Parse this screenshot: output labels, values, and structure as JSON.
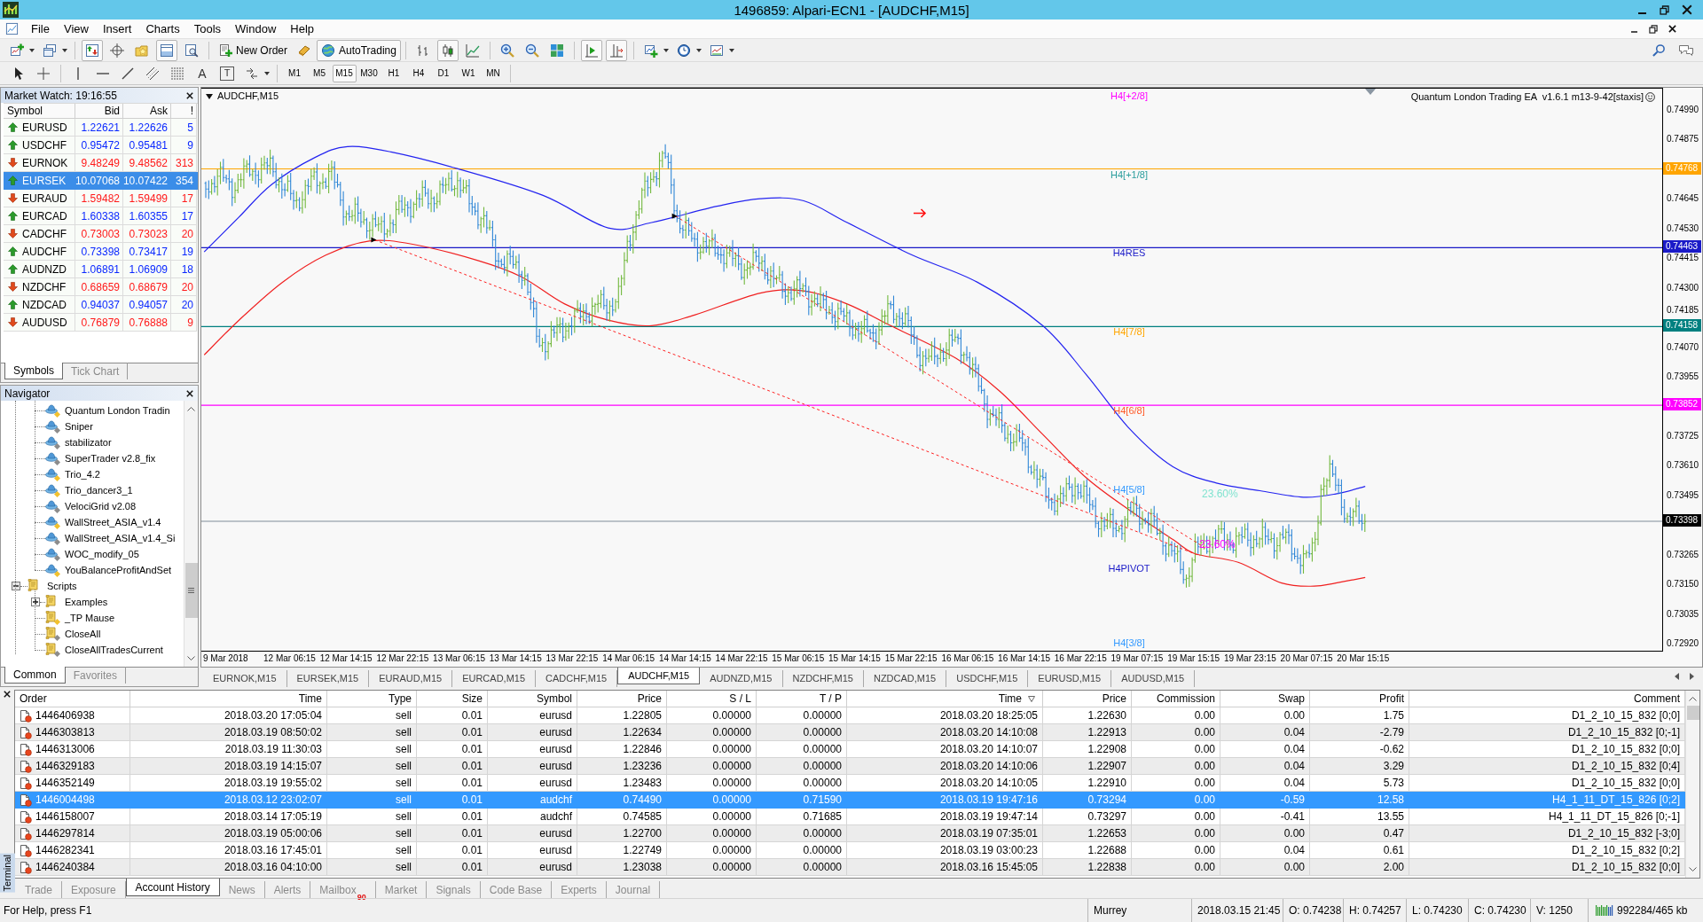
{
  "window": {
    "title": "1496859: Alpari-ECN1 - [AUDCHF,M15]"
  },
  "menu": [
    "File",
    "View",
    "Insert",
    "Charts",
    "Tools",
    "Window",
    "Help"
  ],
  "toolbar": {
    "items": [
      {
        "kind": "icon",
        "pressed": false
      },
      {
        "kind": "icon",
        "pressed": false
      },
      {
        "kind": "icon",
        "pressed": true
      },
      {
        "kind": "icon",
        "pressed": false
      },
      {
        "kind": "icon",
        "pressed": false
      },
      {
        "kind": "icon",
        "pressed": true
      },
      {
        "kind": "icon",
        "pressed": false
      },
      {
        "kind": "text",
        "label": "New Order",
        "pressed": false
      },
      {
        "kind": "icon",
        "pressed": false
      },
      {
        "kind": "text",
        "label": "AutoTrading",
        "pressed": true
      },
      {
        "kind": "icon",
        "pressed": false
      },
      {
        "kind": "icon",
        "pressed": true
      },
      {
        "kind": "icon",
        "pressed": false
      },
      {
        "kind": "icon",
        "pressed": false
      },
      {
        "kind": "icon",
        "pressed": false
      },
      {
        "kind": "icon",
        "pressed": false
      },
      {
        "kind": "icon",
        "pressed": true
      },
      {
        "kind": "icon",
        "pressed": true
      },
      {
        "kind": "icon",
        "pressed": false
      },
      {
        "kind": "icon",
        "pressed": false
      },
      {
        "kind": "icon",
        "pressed": false
      }
    ]
  },
  "drawing_tools": {
    "text_tool": "A",
    "text_label_tool": "T"
  },
  "timeframes": [
    {
      "label": "M1",
      "selected": false
    },
    {
      "label": "M5",
      "selected": false
    },
    {
      "label": "M15",
      "selected": true
    },
    {
      "label": "M30",
      "selected": false
    },
    {
      "label": "H1",
      "selected": false
    },
    {
      "label": "H4",
      "selected": false
    },
    {
      "label": "D1",
      "selected": false
    },
    {
      "label": "W1",
      "selected": false
    },
    {
      "label": "MN",
      "selected": false
    }
  ],
  "market_watch": {
    "title": "Market Watch: 19:16:55",
    "columns": [
      "Symbol",
      "Bid",
      "Ask",
      "!"
    ],
    "rows": [
      {
        "symbol": "EURUSD",
        "bid": "1.22621",
        "ask": "1.22626",
        "spread": "5",
        "rising": true,
        "selected": false
      },
      {
        "symbol": "USDCHF",
        "bid": "0.95472",
        "ask": "0.95481",
        "spread": "9",
        "rising": true,
        "selected": false
      },
      {
        "symbol": "EURNOK",
        "bid": "9.48249",
        "ask": "9.48562",
        "spread": "313",
        "rising": false,
        "selected": false
      },
      {
        "symbol": "EURSEK",
        "bid": "10.07068",
        "ask": "10.07422",
        "spread": "354",
        "rising": true,
        "selected": true
      },
      {
        "symbol": "EURAUD",
        "bid": "1.59482",
        "ask": "1.59499",
        "spread": "17",
        "rising": false,
        "selected": false
      },
      {
        "symbol": "EURCAD",
        "bid": "1.60338",
        "ask": "1.60355",
        "spread": "17",
        "rising": true,
        "selected": false
      },
      {
        "symbol": "CADCHF",
        "bid": "0.73003",
        "ask": "0.73023",
        "spread": "20",
        "rising": false,
        "selected": false
      },
      {
        "symbol": "AUDCHF",
        "bid": "0.73398",
        "ask": "0.73417",
        "spread": "19",
        "rising": true,
        "selected": false
      },
      {
        "symbol": "AUDNZD",
        "bid": "1.06891",
        "ask": "1.06909",
        "spread": "18",
        "rising": true,
        "selected": false
      },
      {
        "symbol": "NZDCHF",
        "bid": "0.68659",
        "ask": "0.68679",
        "spread": "20",
        "rising": false,
        "selected": false
      },
      {
        "symbol": "NZDCAD",
        "bid": "0.94037",
        "ask": "0.94057",
        "spread": "20",
        "rising": true,
        "selected": false
      },
      {
        "symbol": "AUDUSD",
        "bid": "0.76879",
        "ask": "0.76888",
        "spread": "9",
        "rising": false,
        "selected": false
      }
    ],
    "tabs": [
      {
        "label": "Symbols",
        "selected": true
      },
      {
        "label": "Tick Chart",
        "selected": false
      }
    ]
  },
  "navigator": {
    "title": "Navigator",
    "experts": [
      {
        "label": "Quantum London Tradin",
        "color": "#f2c12e"
      },
      {
        "label": "Sniper",
        "color": "#8c8c8c"
      },
      {
        "label": "stabilizator",
        "color": "#8c8c8c"
      },
      {
        "label": "SuperTrader v2.8_fix",
        "color": "#8c8c8c"
      },
      {
        "label": "Trio_4.2",
        "color": "#f2c12e"
      },
      {
        "label": "Trio_dancer3_1",
        "color": "#f2c12e"
      },
      {
        "label": "VelociGrid v2.08",
        "color": "#8c8c8c"
      },
      {
        "label": "WallStreet_ASIA_v1.4",
        "color": "#f2c12e"
      },
      {
        "label": "WallStreet_ASIA_v1.4_Si",
        "color": "#8c8c8c"
      },
      {
        "label": "WOC_modify_05",
        "color": "#8c8c8c"
      },
      {
        "label": "YouBalanceProfitAndSet",
        "color": "#f2c12e"
      }
    ],
    "scripts": {
      "label": "Scripts",
      "expanded": true,
      "children": [
        {
          "label": "Examples",
          "folder": true,
          "expanded": false
        },
        {
          "label": "_TP Mause",
          "folder": false,
          "color": "#f2c12e"
        },
        {
          "label": "CloseAll",
          "folder": false,
          "color": "#8c8c8c"
        },
        {
          "label": "CloseAllTradesCurrent",
          "folder": false,
          "color": "#8c8c8c"
        }
      ]
    },
    "tabs": [
      {
        "label": "Common",
        "selected": true
      },
      {
        "label": "Favorites",
        "selected": false
      }
    ]
  },
  "chart": {
    "title": "AUDCHF,M15",
    "expert_label": "Quantum London Trading EA  v1.6.1 m13-9-42[staxis]",
    "levels": [
      {
        "label": "H4[+2/8]",
        "color": "#ff00ff"
      },
      {
        "label": "H4[+1/8]",
        "color": "#2a9d9d",
        "line": {
          "color": "#ffa500",
          "tag": "0.74768"
        }
      },
      {
        "label": "H4RES",
        "color": "#1a1ac8",
        "line": {
          "color": "#1a1ac8",
          "tag": "0.74463"
        }
      },
      {
        "label": "H4[7/8]",
        "color": "#ffa500",
        "line": {
          "color": "#008080",
          "tag": "0.74158"
        }
      },
      {
        "label": "H4[6/8]",
        "color": "#ff5a28",
        "line": {
          "color": "#ff00ff",
          "tag": "0.73852"
        }
      },
      {
        "label": "H4[5/8]",
        "color": "#3399ff"
      },
      {
        "label": "H4PIVOT",
        "color": "#1a1ac8"
      },
      {
        "label": "H4[3/8]",
        "color": "#3399ff"
      }
    ],
    "fib_labels": [
      {
        "text": "23.60%",
        "color": "#7fe3cf"
      },
      {
        "text": "23.60%",
        "color": "#ff00ff"
      }
    ],
    "current_price": {
      "tag": "0.73398"
    },
    "price_axis": [
      "0.74990",
      "0.74875",
      "0.74645",
      "0.74530",
      "0.74415",
      "0.74300",
      "0.74185",
      "0.74070",
      "0.73955",
      "0.73725",
      "0.73610",
      "0.73495",
      "0.73265",
      "0.73150",
      "0.73035",
      "0.72920"
    ],
    "time_axis": [
      "9 Mar 2018",
      "12 Mar 06:15",
      "12 Mar 14:15",
      "12 Mar 22:15",
      "13 Mar 06:15",
      "13 Mar 14:15",
      "13 Mar 22:15",
      "14 Mar 06:15",
      "14 Mar 14:15",
      "14 Mar 22:15",
      "15 Mar 06:15",
      "15 Mar 14:15",
      "15 Mar 22:15",
      "16 Mar 06:15",
      "16 Mar 14:15",
      "16 Mar 22:15",
      "19 Mar 07:15",
      "19 Mar 15:15",
      "19 Mar 23:15",
      "20 Mar 07:15",
      "20 Mar 15:15"
    ]
  },
  "chart_tabs": [
    {
      "label": "EURNOK,M15",
      "selected": false
    },
    {
      "label": "EURSEK,M15",
      "selected": false
    },
    {
      "label": "EURAUD,M15",
      "selected": false
    },
    {
      "label": "EURCAD,M15",
      "selected": false
    },
    {
      "label": "CADCHF,M15",
      "selected": false
    },
    {
      "label": "AUDCHF,M15",
      "selected": true
    },
    {
      "label": "AUDNZD,M15",
      "selected": false
    },
    {
      "label": "NZDCHF,M15",
      "selected": false
    },
    {
      "label": "NZDCAD,M15",
      "selected": false
    },
    {
      "label": "USDCHF,M15",
      "selected": false
    },
    {
      "label": "EURUSD,M15",
      "selected": false
    },
    {
      "label": "AUDUSD,M15",
      "selected": false
    }
  ],
  "terminal": {
    "title": "Terminal",
    "columns": [
      {
        "label": "Order",
        "sorted": false
      },
      {
        "label": "Time",
        "sorted": false
      },
      {
        "label": "Type",
        "sorted": false
      },
      {
        "label": "Size",
        "sorted": false
      },
      {
        "label": "Symbol",
        "sorted": false
      },
      {
        "label": "Price",
        "sorted": false
      },
      {
        "label": "S / L",
        "sorted": false
      },
      {
        "label": "T / P",
        "sorted": false
      },
      {
        "label": "Time",
        "sorted": true
      },
      {
        "label": "Price",
        "sorted": false
      },
      {
        "label": "Commission",
        "sorted": false
      },
      {
        "label": "Swap",
        "sorted": false
      },
      {
        "label": "Profit",
        "sorted": false
      },
      {
        "label": "Comment",
        "sorted": false
      }
    ],
    "rows": [
      {
        "order": "1446406938",
        "time": "2018.03.20 17:05:04",
        "type": "sell",
        "size": "0.01",
        "symbol": "eurusd",
        "price": "1.22805",
        "sl": "0.00000",
        "tp": "0.00000",
        "close_time": "2018.03.20 18:25:05",
        "close_price": "1.22630",
        "commission": "0.00",
        "swap": "0.00",
        "profit": "1.75",
        "comment": "D1_2_10_15_832 [0;0]",
        "selected": false
      },
      {
        "order": "1446303813",
        "time": "2018.03.19 08:50:02",
        "type": "sell",
        "size": "0.01",
        "symbol": "eurusd",
        "price": "1.22634",
        "sl": "0.00000",
        "tp": "0.00000",
        "close_time": "2018.03.20 14:10:08",
        "close_price": "1.22913",
        "commission": "0.00",
        "swap": "0.04",
        "profit": "-2.79",
        "comment": "D1_2_10_15_832 [0;-1]",
        "selected": false
      },
      {
        "order": "1446313006",
        "time": "2018.03.19 11:30:03",
        "type": "sell",
        "size": "0.01",
        "symbol": "eurusd",
        "price": "1.22846",
        "sl": "0.00000",
        "tp": "0.00000",
        "close_time": "2018.03.20 14:10:07",
        "close_price": "1.22908",
        "commission": "0.00",
        "swap": "0.04",
        "profit": "-0.62",
        "comment": "D1_2_10_15_832 [0;0]",
        "selected": false
      },
      {
        "order": "1446329183",
        "time": "2018.03.19 14:15:07",
        "type": "sell",
        "size": "0.01",
        "symbol": "eurusd",
        "price": "1.23236",
        "sl": "0.00000",
        "tp": "0.00000",
        "close_time": "2018.03.20 14:10:06",
        "close_price": "1.22907",
        "commission": "0.00",
        "swap": "0.04",
        "profit": "3.29",
        "comment": "D1_2_10_15_832 [0;4]",
        "selected": false
      },
      {
        "order": "1446352149",
        "time": "2018.03.19 19:55:02",
        "type": "sell",
        "size": "0.01",
        "symbol": "eurusd",
        "price": "1.23483",
        "sl": "0.00000",
        "tp": "0.00000",
        "close_time": "2018.03.20 14:10:05",
        "close_price": "1.22910",
        "commission": "0.00",
        "swap": "0.04",
        "profit": "5.73",
        "comment": "D1_2_10_15_832 [0;0]",
        "selected": false
      },
      {
        "order": "1446004498",
        "time": "2018.03.12 23:02:07",
        "type": "sell",
        "size": "0.01",
        "symbol": "audchf",
        "price": "0.74490",
        "sl": "0.00000",
        "tp": "0.71590",
        "close_time": "2018.03.19 19:47:16",
        "close_price": "0.73294",
        "commission": "0.00",
        "swap": "-0.59",
        "profit": "12.58",
        "comment": "H4_1_11_DT_15_826 [0;2]",
        "selected": true
      },
      {
        "order": "1446158007",
        "time": "2018.03.14 17:05:19",
        "type": "sell",
        "size": "0.01",
        "symbol": "audchf",
        "price": "0.74585",
        "sl": "0.00000",
        "tp": "0.71685",
        "close_time": "2018.03.19 19:47:14",
        "close_price": "0.73297",
        "commission": "0.00",
        "swap": "-0.41",
        "profit": "13.55",
        "comment": "H4_1_11_DT_15_826 [0;-1]",
        "selected": false
      },
      {
        "order": "1446297814",
        "time": "2018.03.19 05:00:06",
        "type": "sell",
        "size": "0.01",
        "symbol": "eurusd",
        "price": "1.22700",
        "sl": "0.00000",
        "tp": "0.00000",
        "close_time": "2018.03.19 07:35:01",
        "close_price": "1.22653",
        "commission": "0.00",
        "swap": "0.00",
        "profit": "0.47",
        "comment": "D1_2_10_15_832 [-3;0]",
        "selected": false
      },
      {
        "order": "1446282341",
        "time": "2018.03.16 17:45:01",
        "type": "sell",
        "size": "0.01",
        "symbol": "eurusd",
        "price": "1.22749",
        "sl": "0.00000",
        "tp": "0.00000",
        "close_time": "2018.03.19 03:00:23",
        "close_price": "1.22688",
        "commission": "0.00",
        "swap": "0.04",
        "profit": "0.61",
        "comment": "D1_2_10_15_832 [0;2]",
        "selected": false
      },
      {
        "order": "1446240384",
        "time": "2018.03.16 04:10:00",
        "type": "sell",
        "size": "0.01",
        "symbol": "eurusd",
        "price": "1.23038",
        "sl": "0.00000",
        "tp": "0.00000",
        "close_time": "2018.03.16 15:45:05",
        "close_price": "1.22838",
        "commission": "0.00",
        "swap": "0.00",
        "profit": "2.00",
        "comment": "D1_2_10_15_832 [0;0]",
        "selected": false
      }
    ],
    "tabs": [
      {
        "label": "Trade",
        "selected": false
      },
      {
        "label": "Exposure",
        "selected": false
      },
      {
        "label": "Account History",
        "selected": true
      },
      {
        "label": "News",
        "selected": false
      },
      {
        "label": "Alerts",
        "selected": false
      },
      {
        "label": "Mailbox",
        "badge": "90",
        "selected": false
      },
      {
        "label": "Market",
        "selected": false
      },
      {
        "label": "Signals",
        "selected": false
      },
      {
        "label": "Code Base",
        "selected": false
      },
      {
        "label": "Experts",
        "selected": false
      },
      {
        "label": "Journal",
        "selected": false
      }
    ]
  },
  "status_bar": {
    "help": "For Help, press F1",
    "template": "Murrey",
    "datetime": "2018.03.15 21:45",
    "open": "O: 0.74238",
    "high": "H: 0.74257",
    "low": "L: 0.74230",
    "close": "C: 0.74230",
    "volume": "V: 1250",
    "traffic": "992284/465 kb"
  }
}
